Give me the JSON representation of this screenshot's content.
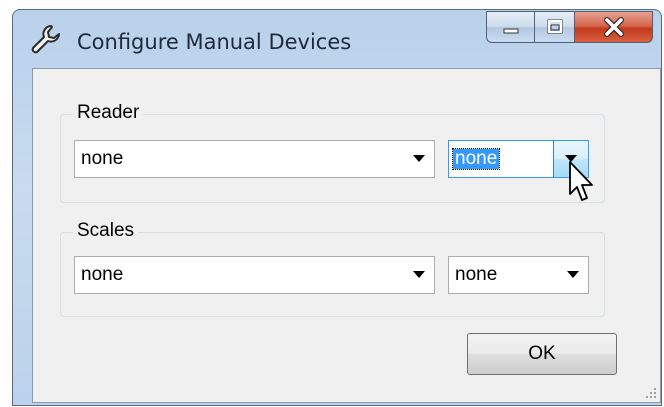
{
  "window": {
    "title": "Configure Manual Devices",
    "icon": "wrench-icon",
    "controls": [
      "minimize-icon",
      "maximize-icon",
      "close-icon"
    ]
  },
  "reader": {
    "label": "Reader",
    "device": {
      "value": "none"
    },
    "port": {
      "value": "none",
      "state": "focused-selected"
    }
  },
  "scales": {
    "label": "Scales",
    "device": {
      "value": "none"
    },
    "port": {
      "value": "none"
    }
  },
  "ok_button": {
    "label": "OK"
  },
  "colors": {
    "selection": "#3399ff",
    "close_button": "#c9462c",
    "dialog_background": "#f0f0f0"
  }
}
